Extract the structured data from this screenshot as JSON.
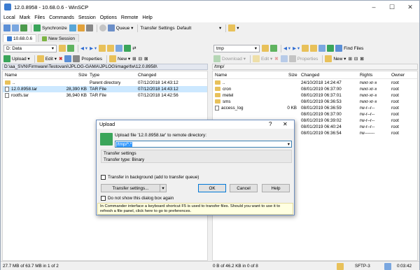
{
  "window": {
    "title": "12.0.8958 - 10.68.0.6 - WinSCP",
    "minimize": "–",
    "maximize": "☐",
    "close": "✕"
  },
  "menu": [
    "Local",
    "Mark",
    "Files",
    "Commands",
    "Session",
    "Options",
    "Remote",
    "Help"
  ],
  "toolbar1": {
    "synchronize": "Synchronize",
    "queue": "Queue",
    "transfer_settings_label": "Transfer Settings",
    "transfer_settings_value": "Default"
  },
  "tabs": [
    "10.68.0.6",
    "New Session"
  ],
  "local": {
    "drive": "D: Data",
    "upload": "Upload",
    "edit": "Edit",
    "properties": "Properties",
    "new": "New",
    "path": "D:\\aa_SVN\\Firmware\\Testovani\\JPLOG-GAMA\\JPLOG\\image\\fw\\12.0.8958\\",
    "columns": [
      "Name",
      "Size",
      "Type",
      "Changed"
    ],
    "files": [
      {
        "name": "..",
        "size": "",
        "type": "Parent directory",
        "changed": "07/12/2018  14:43:12",
        "kind": "up"
      },
      {
        "name": "12.0.8958.tar",
        "size": "28,390 KB",
        "type": "TAR File",
        "changed": "07/12/2018  14:43:12",
        "kind": "file"
      },
      {
        "name": "rootfs.tar",
        "size": "36,940 KB",
        "type": "TAR File",
        "changed": "07/12/2018  14:42:56",
        "kind": "file"
      }
    ],
    "status": "27.7 MB of 63.7 MB in 1 of 2"
  },
  "remote": {
    "dir": "tmp",
    "download": "Download",
    "edit": "Edit",
    "properties": "Properties",
    "new": "New",
    "find": "Find Files",
    "path": "/tmp/",
    "columns": [
      "Name",
      "Size",
      "Changed",
      "Rights",
      "Owner"
    ],
    "files": [
      {
        "name": "..",
        "size": "",
        "changed": "24/10/2018  14:24:47",
        "rights": "rwxr-xr-x",
        "owner": "root",
        "kind": "up"
      },
      {
        "name": "cron",
        "size": "",
        "changed": "08/01/2019  06:37:00",
        "rights": "rwxr-xr-x",
        "owner": "root",
        "kind": "folder"
      },
      {
        "name": "metel",
        "size": "",
        "changed": "08/01/2019  06:37:01",
        "rights": "rwxr-xr-x",
        "owner": "root",
        "kind": "folder"
      },
      {
        "name": "sms",
        "size": "",
        "changed": "08/01/2019  06:36:53",
        "rights": "rwxr-xr-x",
        "owner": "root",
        "kind": "folder"
      },
      {
        "name": "access_log",
        "size": "0 KB",
        "changed": "08/01/2019  06:36:59",
        "rights": "rw-r--r--",
        "owner": "root",
        "kind": "file"
      },
      {
        "name": "",
        "size": "",
        "changed": "08/01/2019  06:37:00",
        "rights": "rw-r--r--",
        "owner": "root",
        "kind": "none"
      },
      {
        "name": "",
        "size": "",
        "changed": "08/01/2019  06:39:02",
        "rights": "rw-r--r--",
        "owner": "root",
        "kind": "none"
      },
      {
        "name": "",
        "size": "",
        "changed": "08/01/2019  06:40:24",
        "rights": "rw-r--r--",
        "owner": "root",
        "kind": "none"
      },
      {
        "name": "",
        "size": "",
        "changed": "08/01/2019  06:36:54",
        "rights": "rw-------",
        "owner": "root",
        "kind": "none"
      }
    ],
    "status": "0 B of 46.2 KB in 0 of 8"
  },
  "statusbar": {
    "protocol": "SFTP-3",
    "time": "0:03:42"
  },
  "dialog": {
    "title": "Upload",
    "help_glyph": "?",
    "close_glyph": "✕",
    "prompt": "Upload file '12.0.8958.tar' to remote directory:",
    "target": "/tmp/*.*",
    "settings_header": "Transfer settings",
    "settings_value": "Transfer type: Binary",
    "background_label": "Transfer in background (add to transfer queue)",
    "btn_settings": "Transfer settings...",
    "btn_ok": "OK",
    "btn_cancel": "Cancel",
    "btn_help": "Help",
    "dont_show": "Do not show this dialog box again",
    "info": "In Commander interface a keyboard shortcut F5 is used to transfer files. Should you want to use it to refresh a file panel, click here to go to preferences."
  }
}
